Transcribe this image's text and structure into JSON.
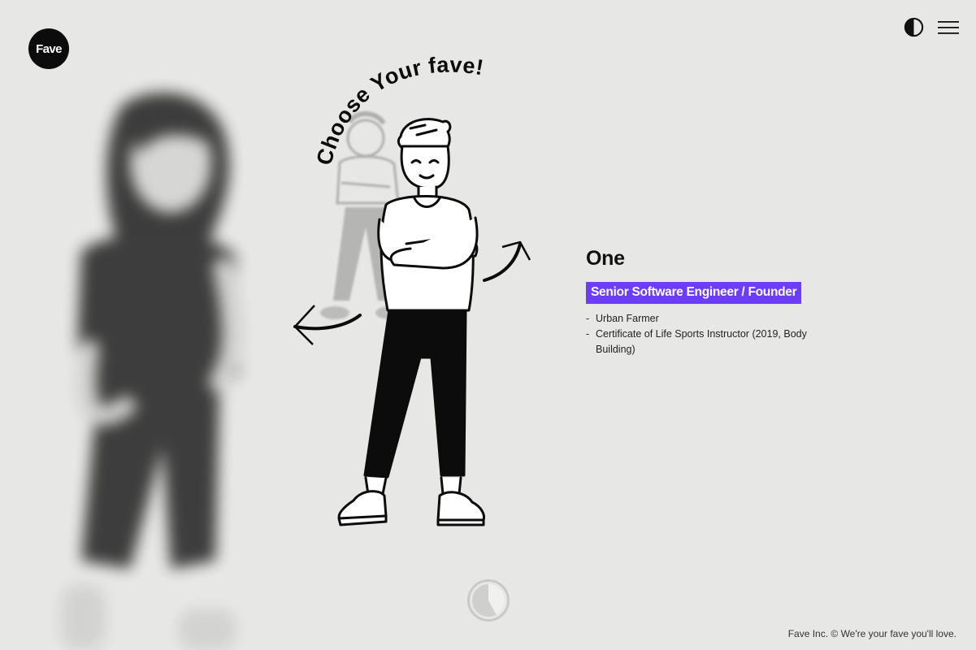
{
  "brand": {
    "logo_text": "Fave",
    "footer": "Fave Inc. © We're your fave you'll love."
  },
  "header": {
    "theme_icon": "half-moon-contrast-icon",
    "menu_icon": "hamburger-menu-icon"
  },
  "hero": {
    "curved_title": "Choose Your fave!",
    "prev_icon": "curved-arrow-left-icon",
    "next_icon": "curved-arrow-right-icon"
  },
  "profile": {
    "name": "One",
    "role": "Senior Software Engineer / Founder",
    "details": [
      "Urban Farmer",
      "Certificate of Life Sports Instructor (2019, Body Building)"
    ]
  },
  "timer": {
    "icon": "countdown-pie-icon",
    "progress": 0.42
  },
  "colors": {
    "background": "#e7e7e5",
    "accent": "#6c3cff",
    "ink": "#0c0c0c"
  }
}
